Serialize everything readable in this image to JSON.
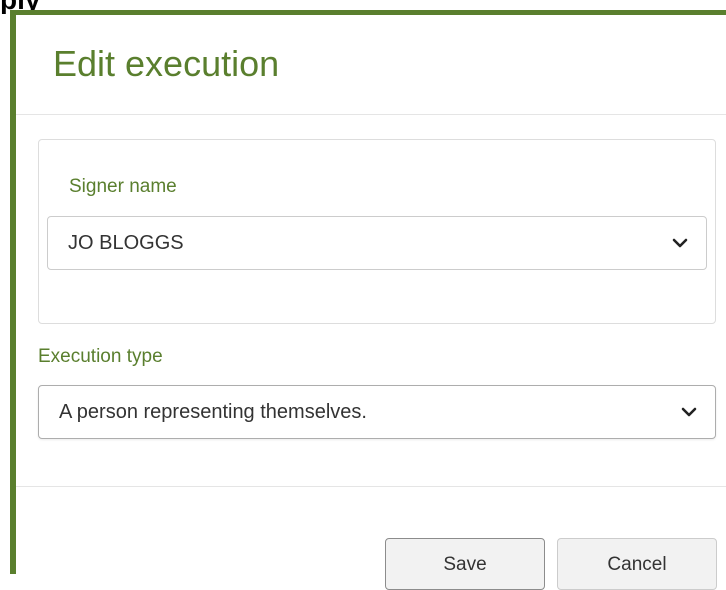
{
  "page_top_fragment": "ply",
  "modal": {
    "title": "Edit execution"
  },
  "signer": {
    "label": "Signer name",
    "selected_value": "JO BLOGGS",
    "chevron_icon": "chevron-down-icon"
  },
  "execution_type": {
    "label": "Execution type",
    "selected_value": "A person representing themselves.",
    "chevron_icon": "chevron-down-icon"
  },
  "footer": {
    "save_label": "Save",
    "cancel_label": "Cancel"
  },
  "colors": {
    "accent_green": "#5a7f2e",
    "button_bg": "#f2f2f2",
    "text": "#333333"
  }
}
